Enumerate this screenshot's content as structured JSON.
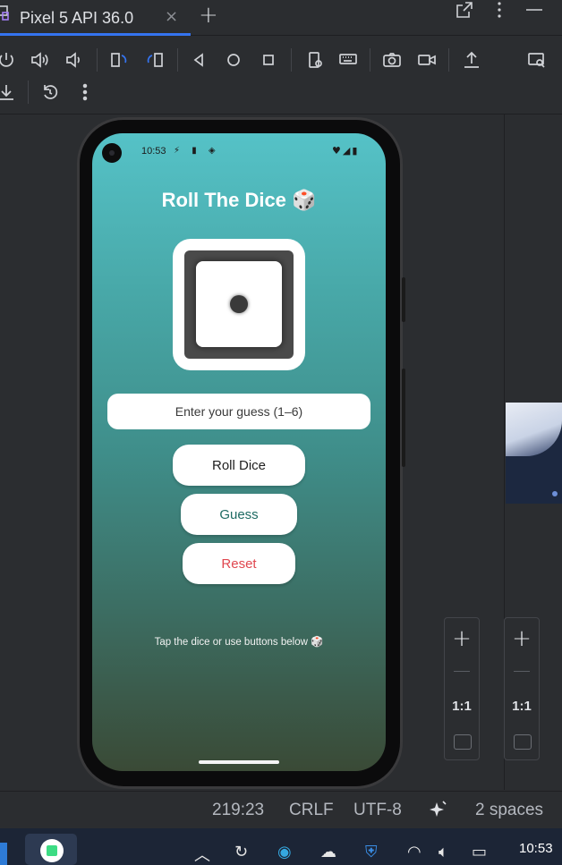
{
  "tab": {
    "title": "Pixel 5 API 36.0",
    "close_glyph": "×",
    "add_glyph": "+"
  },
  "toolbar_icons": [
    "power-icon",
    "volume-up-icon",
    "volume-down-icon",
    "rotate-left-icon",
    "rotate-right-icon",
    "back-icon",
    "home-icon",
    "overview-icon",
    "device-settings-icon",
    "keyboard-icon",
    "camera-icon",
    "record-icon",
    "upload-icon",
    "display-mode-icon",
    "download-icon",
    "reset-icon",
    "more-icon"
  ],
  "device": {
    "status_time": "10:53",
    "status_left_icons": "⚡ ▮ ◈",
    "status_right_icons": "♥◢▮"
  },
  "app": {
    "title": "Roll The Dice 🎲",
    "dice_value": 1,
    "guess_placeholder": "Enter your guess (1–6)",
    "roll_label": "Roll Dice",
    "guess_label": "Guess",
    "reset_label": "Reset",
    "hint": "Tap the dice or use buttons below 🎲"
  },
  "zoom": {
    "plus": "+",
    "ratio": "1:1"
  },
  "statusbar": {
    "position": "219:23",
    "line_ending": "CRLF",
    "encoding": "UTF-8",
    "indent": "2 spaces"
  },
  "taskbar": {
    "clock": "10:53"
  },
  "colors": {
    "accent": "#3574f0",
    "screen_top": "#55c2c7",
    "screen_bottom": "#3a4a36",
    "guess_text": "#1e6b63",
    "reset_text": "#e0474f"
  }
}
